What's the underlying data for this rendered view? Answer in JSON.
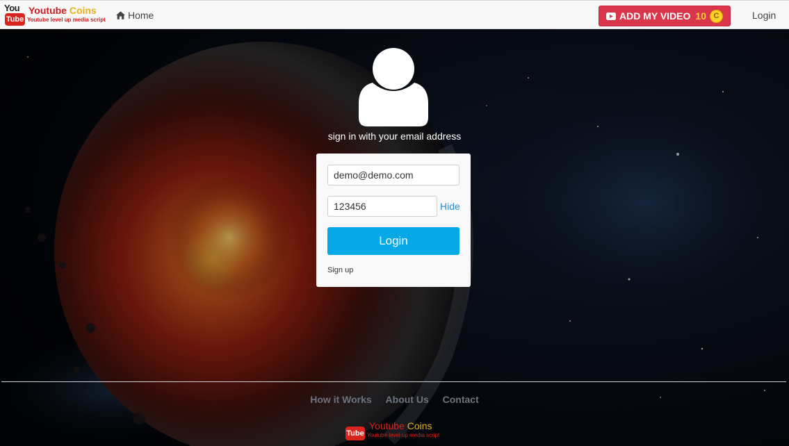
{
  "navbar": {
    "brand": {
      "you": "You",
      "tube": "Tube",
      "title_main": "Youtube",
      "title_accent": "Coins",
      "tagline": "Youtube level up media script"
    },
    "home_label": "Home",
    "add_video_label": "ADD MY VIDEO",
    "coins_count": "10",
    "coin_symbol": "C",
    "login_label": "Login"
  },
  "login": {
    "heading": "sign in with your email address",
    "email_value": "demo@demo.com",
    "password_value": "123456",
    "hide_label": "Hide",
    "button_label": "Login",
    "signup_label": "Sign up"
  },
  "footer": {
    "links": [
      "How it Works",
      "About Us",
      "Contact"
    ],
    "brand": {
      "tube": "Tube",
      "title_main": "Youtube",
      "title_accent": "Coins",
      "tagline": "Youtube level up media script"
    }
  },
  "colors": {
    "navbar_bg": "#f8f8f8",
    "add_video_bg": "#d9364b",
    "login_button": "#07a8e6",
    "link": "#1f8fd1",
    "brand_red": "#cc1c1c",
    "brand_gold": "#e4b21a"
  },
  "icons": {
    "home": "home-icon",
    "play": "youtube-play-icon",
    "coin": "coin-icon",
    "user": "user-avatar-icon"
  }
}
